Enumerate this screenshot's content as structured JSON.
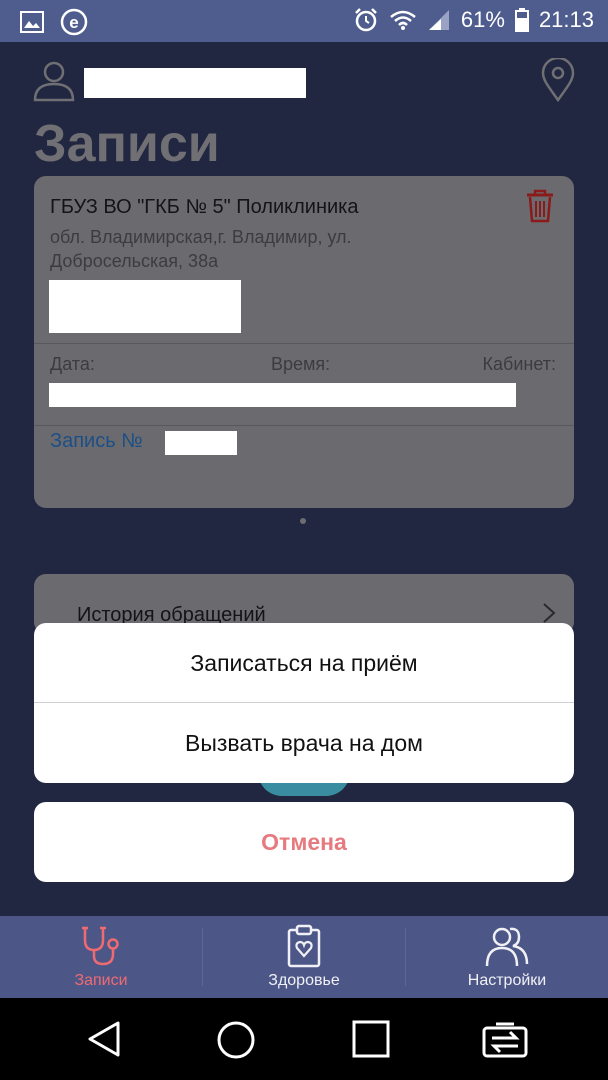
{
  "status_bar": {
    "battery": "61%",
    "time": "21:13",
    "icons": [
      "gallery-icon",
      "browser-icon",
      "alarm-icon",
      "wifi-icon",
      "signal-icon",
      "battery-icon"
    ]
  },
  "header": {
    "title": "Записи",
    "icons": [
      "user-icon",
      "location-pin-icon"
    ]
  },
  "appointment": {
    "clinic": "ГБУЗ ВО \"ГКБ № 5\" Поликлиника",
    "address": "обл. Владимирская,г. Владимир, ул. Добросельская, 38а",
    "date_label": "Дата:",
    "time_label": "Время:",
    "room_label": "Кабинет:",
    "record_label": "Запись №"
  },
  "history": {
    "label": "История обращений"
  },
  "action_sheet": {
    "options": [
      "Записаться на приём",
      "Вызвать врача на дом"
    ],
    "cancel": "Отмена"
  },
  "tabs": [
    {
      "label": "Записи",
      "icon": "stethoscope-icon",
      "active": true
    },
    {
      "label": "Здоровье",
      "icon": "clipboard-heart-icon",
      "active": false
    },
    {
      "label": "Настройки",
      "icon": "users-icon",
      "active": false
    }
  ],
  "navbar": {
    "icons": [
      "back-icon",
      "home-icon",
      "recents-icon",
      "switch-icon"
    ]
  },
  "colors": {
    "status_bar": "#4f5d8e",
    "background": "#212740",
    "card": "#6b6b6f",
    "tab_bar": "#4c5788",
    "active_tab": "#f06a72",
    "cancel_text": "#e77a7e",
    "record_link": "#1b4f86",
    "trash": "#8b1a1a"
  }
}
